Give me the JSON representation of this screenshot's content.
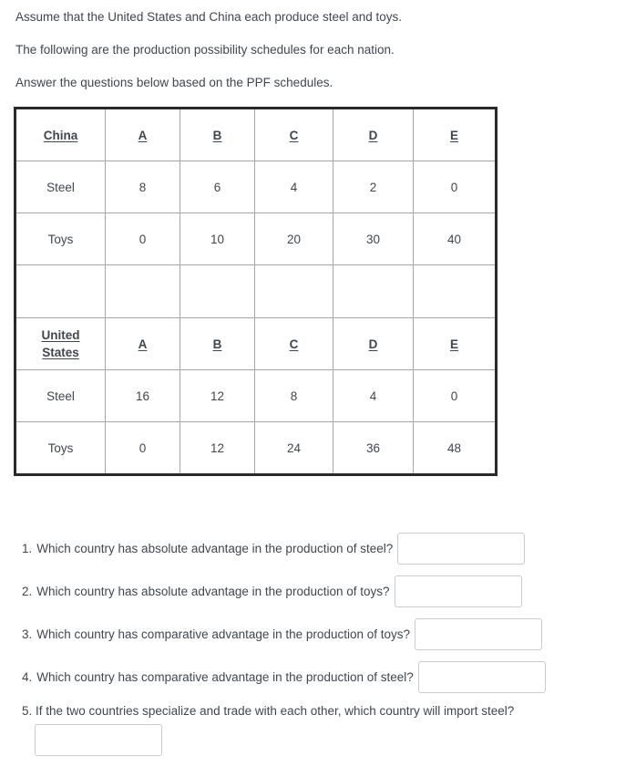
{
  "intro": {
    "lines": [
      "Assume that the United States and China each produce steel and toys.",
      "The following are the production possibility schedules for each nation.",
      "Answer the questions below based on the PPF schedules."
    ]
  },
  "chart_data": {
    "type": "table",
    "title": "Production possibility schedules",
    "columns": [
      "A",
      "B",
      "C",
      "D",
      "E"
    ],
    "tables": [
      {
        "country": "China",
        "rows": [
          {
            "label": "Steel",
            "values": [
              8,
              6,
              4,
              2,
              0
            ]
          },
          {
            "label": "Toys",
            "values": [
              0,
              10,
              20,
              30,
              40
            ]
          }
        ]
      },
      {
        "country": "United States",
        "country_line1": "United",
        "country_line2": "States",
        "rows": [
          {
            "label": "Steel",
            "values": [
              16,
              12,
              8,
              4,
              0
            ]
          },
          {
            "label": "Toys",
            "values": [
              0,
              12,
              24,
              36,
              48
            ]
          }
        ]
      }
    ]
  },
  "questions": [
    {
      "number": "1.",
      "text": "Which country has absolute advantage in the production of steel?",
      "answer": "",
      "placeholder": ""
    },
    {
      "number": "2.",
      "text": "Which country has absolute advantage in the production of toys?",
      "answer": "",
      "placeholder": ""
    },
    {
      "number": "3.",
      "text": "Which country has comparative advantage in the production of toys?",
      "answer": "",
      "placeholder": ""
    },
    {
      "number": "4.",
      "text": "Which country has comparative advantage in the production of steel?",
      "answer": "",
      "placeholder": ""
    },
    {
      "number": "5.",
      "text": "If the two countries specialize and trade with each other, which country will import steel?",
      "answer": "",
      "placeholder": ""
    }
  ],
  "colors": {
    "text": "#3f474e",
    "table_outer_border": "#2a2a2a",
    "table_inner_border": "#a6a6a6",
    "input_border": "#c7cdd1",
    "background": "#ffffff"
  }
}
